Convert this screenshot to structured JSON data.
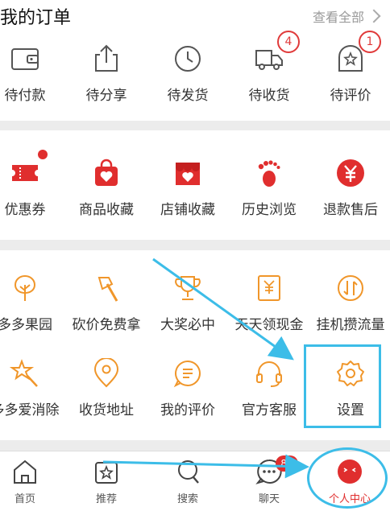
{
  "orders": {
    "title": "我的订单",
    "view_all": "查看全部",
    "items": [
      {
        "label": "待付款",
        "icon": "wallet-icon"
      },
      {
        "label": "待分享",
        "icon": "share-icon"
      },
      {
        "label": "待发货",
        "icon": "clock-icon"
      },
      {
        "label": "待收货",
        "icon": "truck-icon",
        "badge": "4"
      },
      {
        "label": "待评价",
        "icon": "review-icon",
        "badge": "1"
      }
    ]
  },
  "services": {
    "items": [
      {
        "label": "优惠券",
        "icon": "coupon-icon"
      },
      {
        "label": "商品收藏",
        "icon": "bag-heart-icon"
      },
      {
        "label": "店铺收藏",
        "icon": "store-heart-icon"
      },
      {
        "label": "历史浏览",
        "icon": "footprint-icon"
      },
      {
        "label": "退款售后",
        "icon": "refund-icon"
      }
    ]
  },
  "activities": {
    "row1": [
      {
        "label": "多多果园",
        "icon": "tree-icon"
      },
      {
        "label": "砍价免费拿",
        "icon": "axe-icon"
      },
      {
        "label": "大奖必中",
        "icon": "trophy-icon"
      },
      {
        "label": "天天领现金",
        "icon": "cash-icon"
      },
      {
        "label": "挂机攒流量",
        "icon": "traffic-icon"
      }
    ],
    "row2": [
      {
        "label": "多多爱消除",
        "icon": "wand-icon"
      },
      {
        "label": "收货地址",
        "icon": "location-icon"
      },
      {
        "label": "我的评价",
        "icon": "comment-icon"
      },
      {
        "label": "官方客服",
        "icon": "headset-icon"
      },
      {
        "label": "设置",
        "icon": "gear-icon"
      }
    ]
  },
  "tabbar": {
    "items": [
      {
        "label": "首页",
        "icon": "home-icon"
      },
      {
        "label": "推荐",
        "icon": "star-bag-icon"
      },
      {
        "label": "搜索",
        "icon": "search-icon"
      },
      {
        "label": "聊天",
        "icon": "chat-icon",
        "badge": "84"
      },
      {
        "label": "个人中心",
        "icon": "profile-icon",
        "active": true
      }
    ]
  },
  "colors": {
    "accent": "#e02e2e",
    "activity": "#f0962a",
    "highlight": "#3cbde8"
  }
}
